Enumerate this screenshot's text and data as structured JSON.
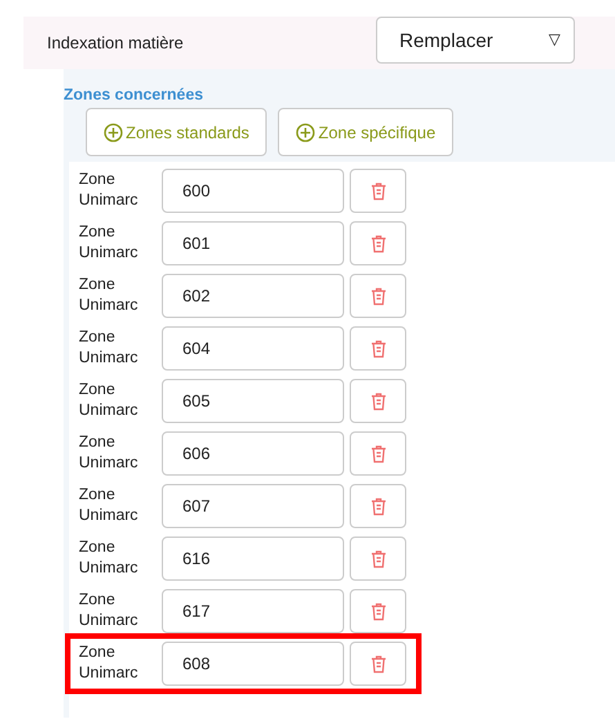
{
  "header": {
    "label": "Indexation matière",
    "select": {
      "value": "Remplacer",
      "caret": "▽"
    }
  },
  "zones": {
    "title": "Zones concernées",
    "buttons": [
      {
        "label": "Zones standards"
      },
      {
        "label": "Zone spécifique"
      }
    ],
    "rows": [
      {
        "label": "Zone Unimarc",
        "value": "600",
        "highlighted": false
      },
      {
        "label": "Zone Unimarc",
        "value": "601",
        "highlighted": false
      },
      {
        "label": "Zone Unimarc",
        "value": "602",
        "highlighted": false
      },
      {
        "label": "Zone Unimarc",
        "value": "604",
        "highlighted": false
      },
      {
        "label": "Zone Unimarc",
        "value": "605",
        "highlighted": false
      },
      {
        "label": "Zone Unimarc",
        "value": "606",
        "highlighted": false
      },
      {
        "label": "Zone Unimarc",
        "value": "607",
        "highlighted": false
      },
      {
        "label": "Zone Unimarc",
        "value": "616",
        "highlighted": false
      },
      {
        "label": "Zone Unimarc",
        "value": "617",
        "highlighted": false
      },
      {
        "label": "Zone Unimarc",
        "value": "608",
        "highlighted": true
      }
    ]
  }
}
